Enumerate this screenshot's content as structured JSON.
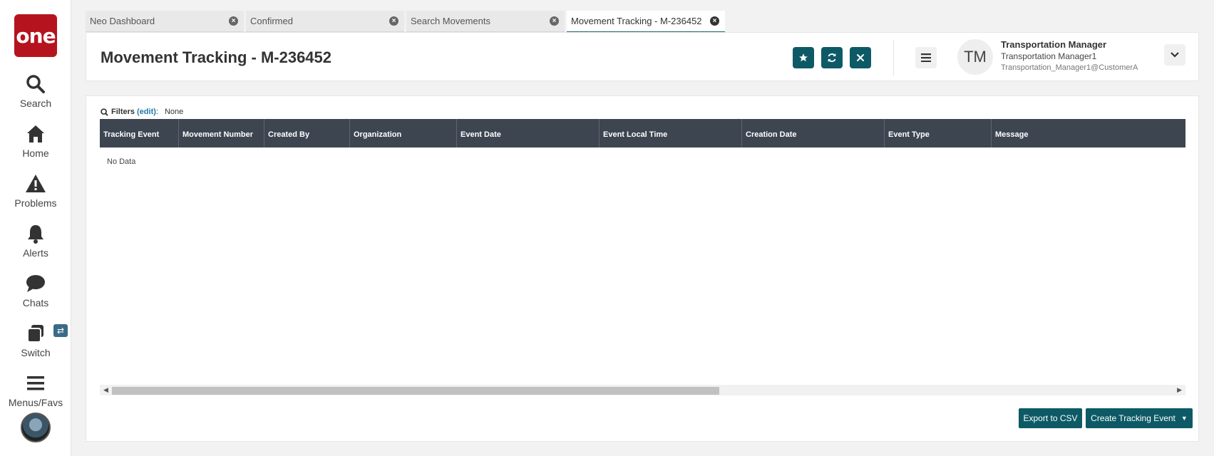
{
  "sidebar": {
    "logo_text": "one",
    "items": [
      {
        "label": "Search",
        "icon": "search-icon"
      },
      {
        "label": "Home",
        "icon": "home-icon"
      },
      {
        "label": "Problems",
        "icon": "warning-icon"
      },
      {
        "label": "Alerts",
        "icon": "bell-icon"
      },
      {
        "label": "Chats",
        "icon": "chat-icon"
      },
      {
        "label": "Switch",
        "icon": "switch-icon"
      },
      {
        "label": "Menus/Favs",
        "icon": "hamburger-icon"
      }
    ],
    "switch_badge": "⇄"
  },
  "tabs": [
    {
      "label": "Neo Dashboard"
    },
    {
      "label": "Confirmed"
    },
    {
      "label": "Search Movements"
    },
    {
      "label": "Movement Tracking - M-236452",
      "active": true
    }
  ],
  "header": {
    "title": "Movement Tracking - M-236452",
    "user": {
      "initials": "TM",
      "name": "Transportation Manager",
      "role": "Transportation Manager1",
      "email": "Transportation_Manager1@CustomerA"
    }
  },
  "filters": {
    "label": "Filters",
    "edit": "(edit)",
    "value": "None"
  },
  "grid": {
    "columns": [
      "Tracking Event",
      "Movement Number",
      "Created By",
      "Organization",
      "Event Date",
      "Event Local Time",
      "Creation Date",
      "Event Type",
      "Message"
    ],
    "empty_text": "No Data"
  },
  "actions": {
    "export_csv": "Export to CSV",
    "create_tracking_event": "Create Tracking Event"
  },
  "colors": {
    "brand": "#b5141f",
    "primary_button": "#0d5a66",
    "grid_header": "#3d4550"
  }
}
